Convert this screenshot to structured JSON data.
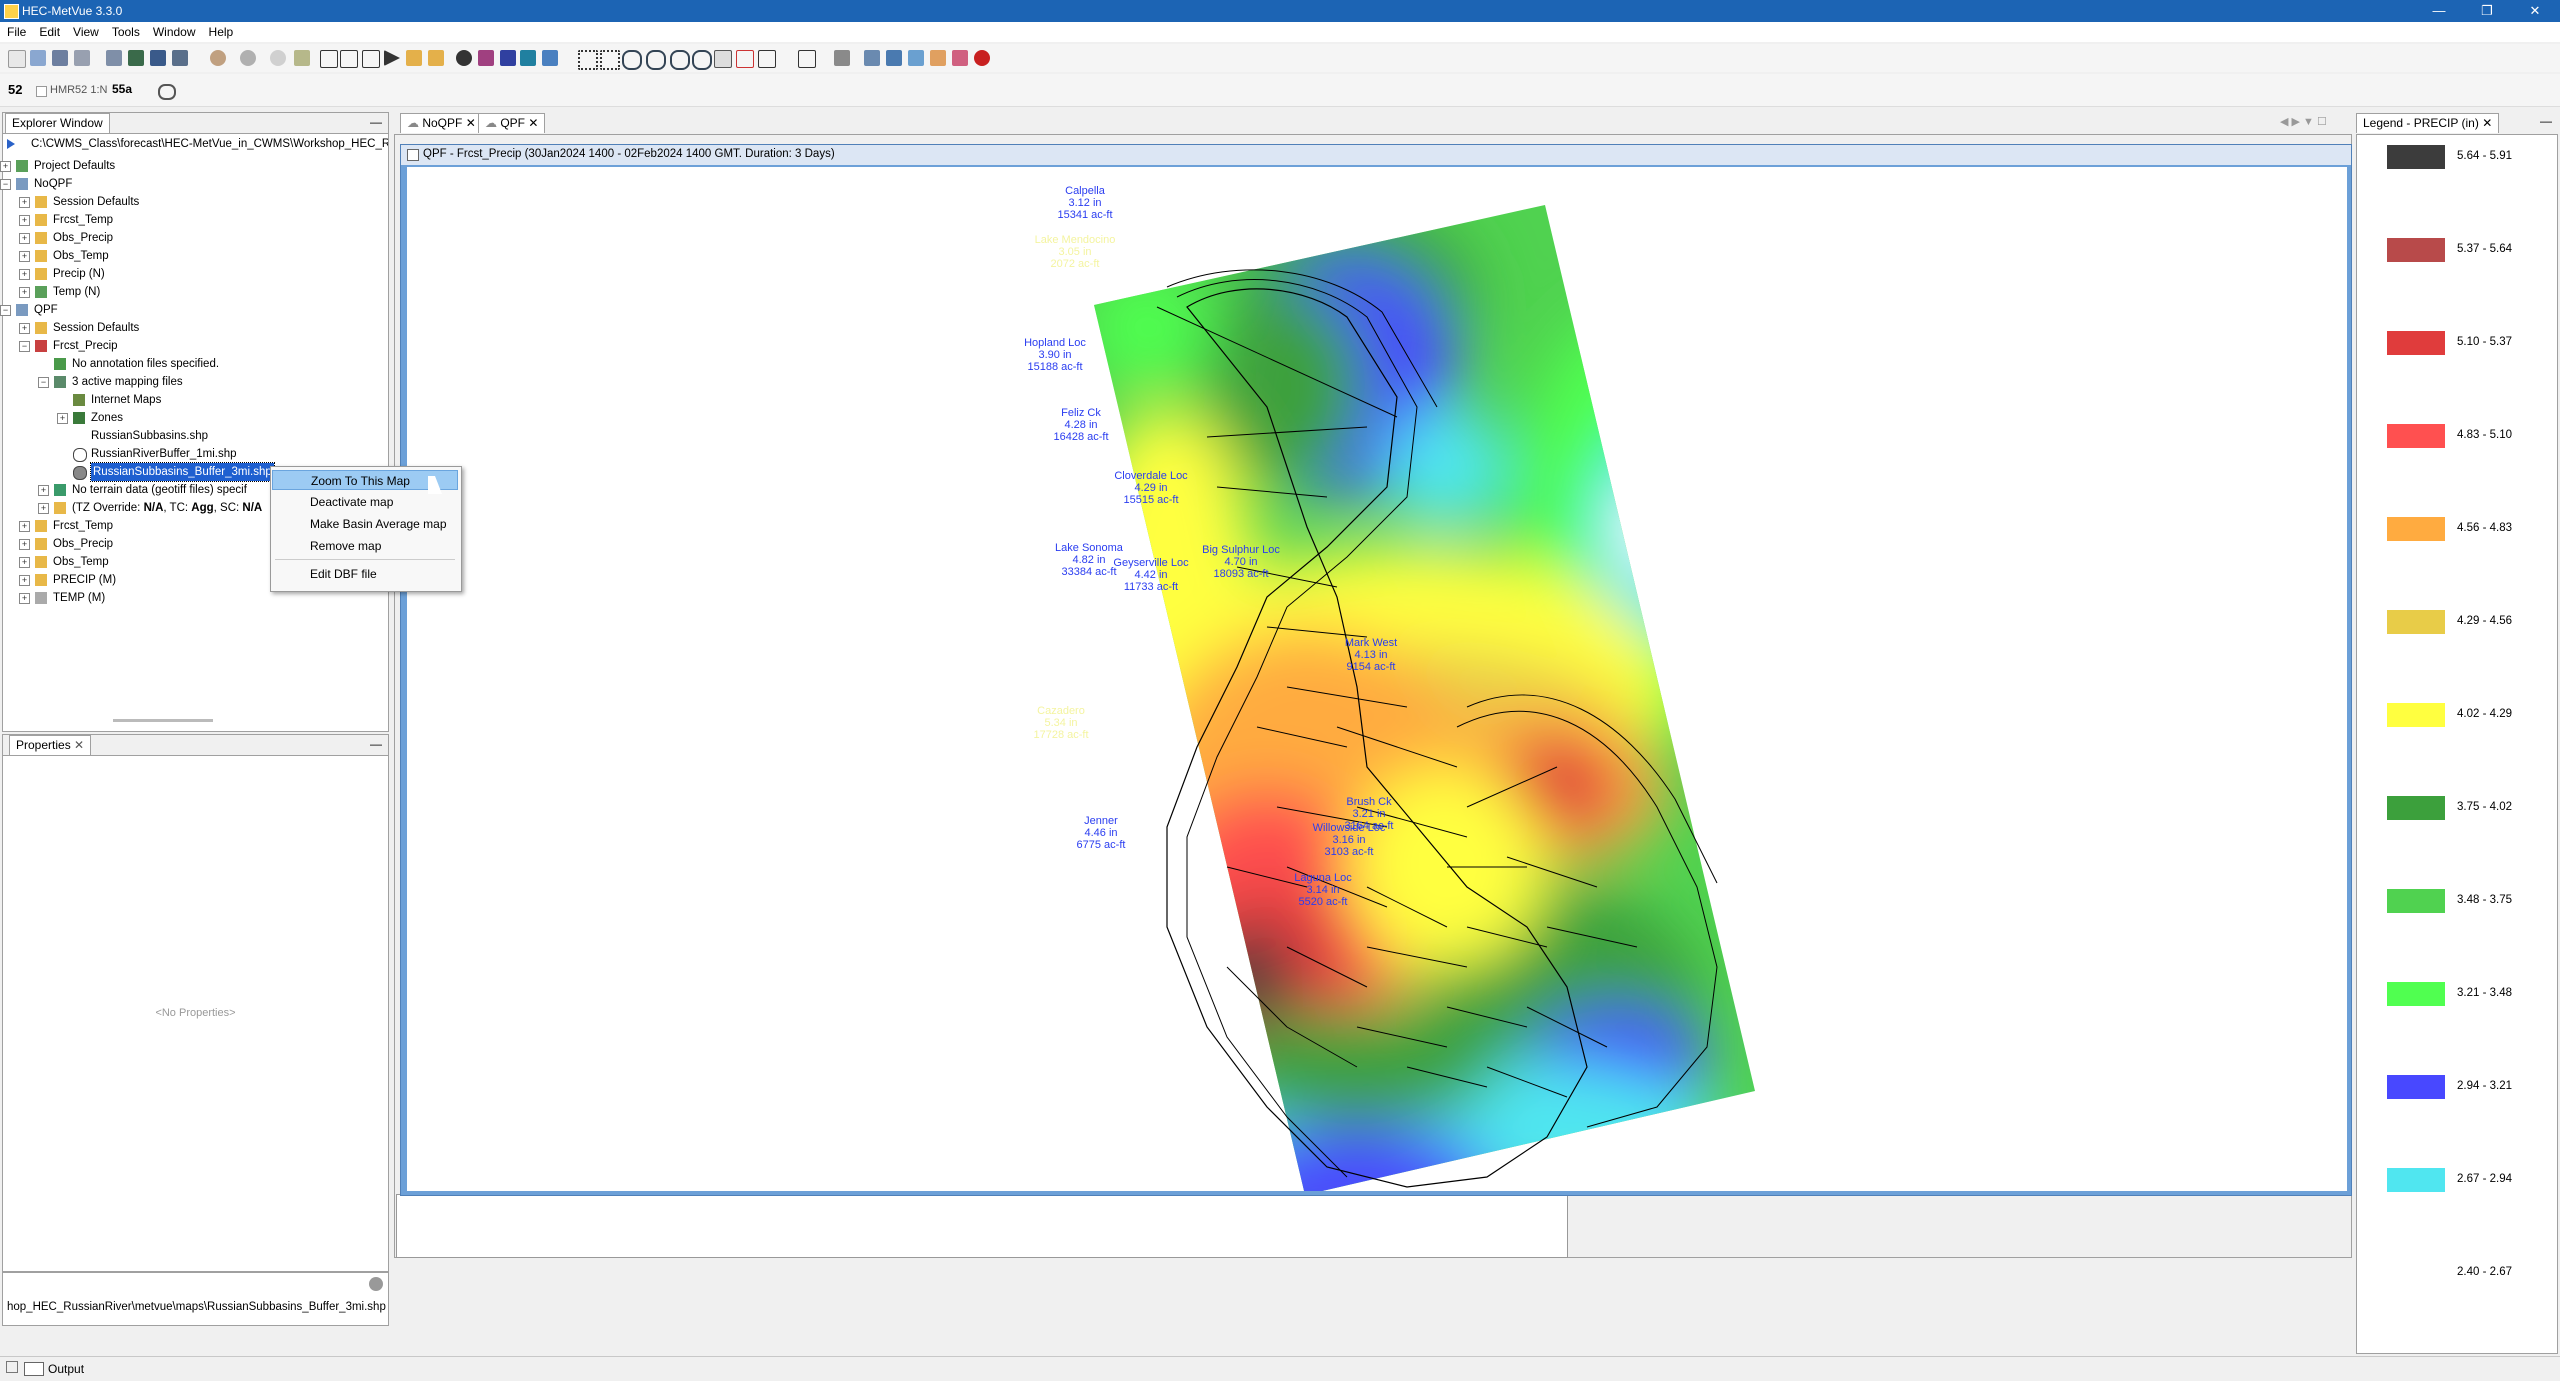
{
  "window": {
    "title": "HEC-MetVue 3.3.0"
  },
  "menu": [
    "File",
    "Edit",
    "View",
    "Tools",
    "Window",
    "Help"
  ],
  "toolbar2": {
    "badge": "52",
    "hmr_label": "HMR52 1:N",
    "badge2": "55a"
  },
  "explorer": {
    "title": "Explorer Window",
    "root_path": "C:\\CWMS_Class\\forecast\\HEC-MetVue_in_CWMS\\Workshop_HEC_R",
    "items": [
      {
        "label": "Project Defaults"
      },
      {
        "label": "NoQPF"
      },
      {
        "label": "Session Defaults"
      },
      {
        "label": "Frcst_Temp"
      },
      {
        "label": "Obs_Precip"
      },
      {
        "label": "Obs_Temp"
      },
      {
        "label": "Precip (N)"
      },
      {
        "label": "Temp (N)"
      },
      {
        "label": "QPF"
      },
      {
        "label": "Session Defaults"
      },
      {
        "label": "Frcst_Precip"
      },
      {
        "label": "No annotation files specified."
      },
      {
        "label": "3 active mapping files"
      },
      {
        "label": "Internet Maps"
      },
      {
        "label": "Zones"
      },
      {
        "label": "RussianSubbasins.shp"
      },
      {
        "label": "RussianRiverBuffer_1mi.shp"
      },
      {
        "label": "RussianSubbasins_Buffer_3mi.shp"
      },
      {
        "label": "No terrain data (geotiff files) specif"
      },
      {
        "label_prefix": "(TZ Override: ",
        "tz": "N/A",
        "tc_prefix": ", TC: ",
        "tc": "Agg",
        "sc_prefix": ", SC: ",
        "sc": "N/A"
      },
      {
        "label": "Frcst_Temp"
      },
      {
        "label": "Obs_Precip"
      },
      {
        "label": "Obs_Temp"
      },
      {
        "label": "PRECIP (M)"
      },
      {
        "label": "TEMP (M)"
      }
    ]
  },
  "context_menu": {
    "items": [
      "Zoom To This Map",
      "Deactivate map",
      "Make Basin Average map",
      "Remove map",
      "Edit DBF file"
    ]
  },
  "properties": {
    "title": "Properties",
    "empty": "<No Properties>"
  },
  "status_path": "hop_HEC_RussianRiver\\metvue\\maps\\RussianSubbasins_Buffer_3mi.shp",
  "output_label": "Output",
  "tabs": [
    "NoQPF",
    "QPF"
  ],
  "map_window": {
    "title": "QPF - Frcst_Precip (30Jan2024 1400 - 02Feb2024 1400 GMT.  Duration: 3 Days)"
  },
  "legend": {
    "title": "Legend - PRECIP (in)",
    "entries": [
      {
        "range": "5.64 - 5.91",
        "color": "#3c3c3c"
      },
      {
        "range": "5.37 - 5.64",
        "color": "#b84a4a"
      },
      {
        "range": "5.10 - 5.37",
        "color": "#e03c3c"
      },
      {
        "range": "4.83 - 5.10",
        "color": "#ff5050"
      },
      {
        "range": "4.56 - 4.83",
        "color": "#ffab40"
      },
      {
        "range": "4.29 - 4.56",
        "color": "#e8cc48"
      },
      {
        "range": "4.02 - 4.29",
        "color": "#ffff40"
      },
      {
        "range": "3.75 - 4.02",
        "color": "#3ca03c"
      },
      {
        "range": "3.48 - 3.75",
        "color": "#50d250"
      },
      {
        "range": "3.21 - 3.48",
        "color": "#50ff50"
      },
      {
        "range": "2.94 - 3.21",
        "color": "#4848ff"
      },
      {
        "range": "2.67 - 2.94",
        "color": "#50e6f0"
      },
      {
        "range": "2.40 - 2.67",
        "color": "#ffffff"
      }
    ]
  },
  "map_labels": [
    {
      "name": "Calpella",
      "val": "3.12 in",
      "vol": "15341 ac-ft"
    },
    {
      "name": "Lake Mendocino",
      "val": "3.05 in",
      "vol": "2072 ac-ft"
    },
    {
      "name": "Hopland Loc",
      "val": "3.90 in",
      "vol": "15188 ac-ft"
    },
    {
      "name": "Feliz Ck",
      "val": "4.28 in",
      "vol": "16428 ac-ft"
    },
    {
      "name": "Cloverdale Loc",
      "val": "4.29 in",
      "vol": "15515 ac-ft"
    },
    {
      "name": "Lake Sonoma",
      "val": "4.82 in",
      "vol": "33384 ac-ft"
    },
    {
      "name": "Geyserville Loc",
      "val": "4.42 in",
      "vol": "11733 ac-ft"
    },
    {
      "name": "Big Sulphur Loc",
      "val": "4.70 in",
      "vol": "18093 ac-ft"
    },
    {
      "name": "Cazadero",
      "val": "5.34 in",
      "vol": "17728 ac-ft"
    },
    {
      "name": "Jenner",
      "val": "4.46 in",
      "vol": "6775 ac-ft"
    },
    {
      "name": "Mark West",
      "val": "4.13 in",
      "vol": "9154 ac-ft"
    },
    {
      "name": "Brush Ck",
      "val": "3.21 in",
      "vol": "3164 ac-ft"
    },
    {
      "name": "Willowside Loc",
      "val": "3.16 in",
      "vol": "3103 ac-ft"
    },
    {
      "name": "Laguna Loc",
      "val": "3.14 in",
      "vol": "5520 ac-ft"
    }
  ]
}
